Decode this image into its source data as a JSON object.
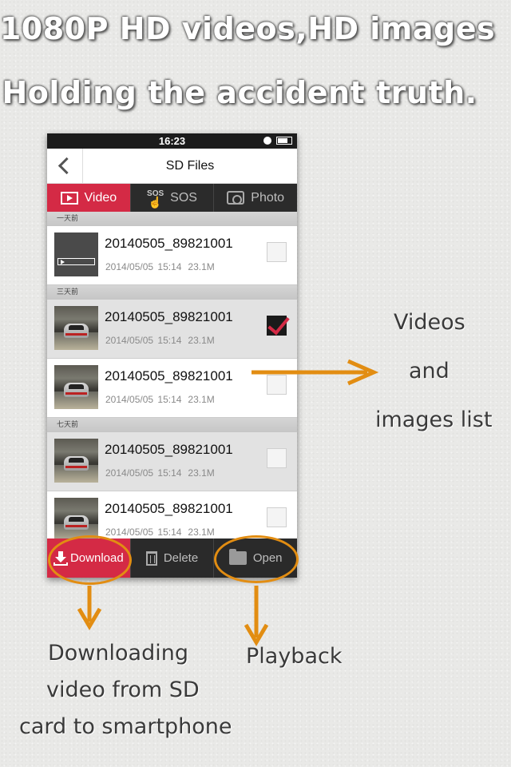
{
  "headlines": {
    "line1": "1080P HD videos,HD images",
    "line2": "Holding the accident truth."
  },
  "statusbar": {
    "time": "16:23"
  },
  "navbar": {
    "title": "SD Files"
  },
  "tabs": [
    {
      "label": "Video",
      "icon": "video-icon",
      "active": true
    },
    {
      "label": "SOS",
      "icon": "sos-hand-icon",
      "icon_text": "SOS",
      "active": false
    },
    {
      "label": "Photo",
      "icon": "camera-icon",
      "active": false
    }
  ],
  "sections": [
    {
      "header": "一天前",
      "items": [
        {
          "name": "20140505_89821001",
          "date": "2014/05/05 15:14",
          "size": "23.1M",
          "thumb": "blank-video",
          "checked": false
        }
      ]
    },
    {
      "header": "三天前",
      "items": [
        {
          "name": "20140505_89821001",
          "date": "2014/05/05 15:14",
          "size": "23.1M",
          "thumb": "car",
          "checked": true
        },
        {
          "name": "20140505_89821001",
          "date": "2014/05/05 15:14",
          "size": "23.1M",
          "thumb": "car",
          "checked": false
        }
      ]
    },
    {
      "header": "七天前",
      "items": [
        {
          "name": "20140505_89821001",
          "date": "2014/05/05 15:14",
          "size": "23.1M",
          "thumb": "car",
          "checked": false
        },
        {
          "name": "20140505_89821001",
          "date": "2014/05/05 15:14",
          "size": "23.1M",
          "thumb": "car",
          "checked": false
        }
      ]
    }
  ],
  "bottombar": {
    "download": "Download",
    "delete": "Delete",
    "open": "Open"
  },
  "callouts": {
    "videos": "Videos",
    "and": "and",
    "images_list": "images list",
    "download_line1": "Downloading",
    "download_line2": "video from SD",
    "download_line3": "card to smartphone",
    "playback": "Playback"
  },
  "colors": {
    "accent": "#d42a45",
    "annotation": "#e28d12",
    "dark_bar": "#2a2a2a"
  }
}
